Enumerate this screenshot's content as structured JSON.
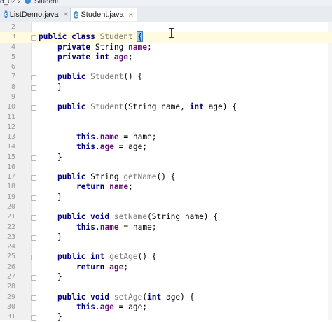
{
  "breadcrumb": {
    "project": "d_02",
    "file": "Student"
  },
  "tabs": [
    {
      "label": "ListDemo.java",
      "close": "×",
      "active": false
    },
    {
      "label": "Student.java",
      "close": "×",
      "active": true
    }
  ],
  "editor": {
    "current_line": "3",
    "lines": [
      {
        "num": "2",
        "code": ""
      },
      {
        "num": "3",
        "code": ""
      },
      {
        "num": "4",
        "code": ""
      },
      {
        "num": "5",
        "code": ""
      },
      {
        "num": "6",
        "code": ""
      },
      {
        "num": "7",
        "code": ""
      },
      {
        "num": "8",
        "code": ""
      },
      {
        "num": "9",
        "code": ""
      },
      {
        "num": "10",
        "code": ""
      },
      {
        "num": "11",
        "code": ""
      },
      {
        "num": "12",
        "code": ""
      },
      {
        "num": "13",
        "code": ""
      },
      {
        "num": "14",
        "code": ""
      },
      {
        "num": "15",
        "code": ""
      },
      {
        "num": "16",
        "code": ""
      },
      {
        "num": "17",
        "code": ""
      },
      {
        "num": "18",
        "code": ""
      },
      {
        "num": "19",
        "code": ""
      },
      {
        "num": "20",
        "code": ""
      },
      {
        "num": "21",
        "code": ""
      },
      {
        "num": "22",
        "code": ""
      },
      {
        "num": "23",
        "code": ""
      },
      {
        "num": "24",
        "code": ""
      },
      {
        "num": "25",
        "code": ""
      },
      {
        "num": "26",
        "code": ""
      },
      {
        "num": "27",
        "code": ""
      },
      {
        "num": "28",
        "code": ""
      },
      {
        "num": "29",
        "code": ""
      },
      {
        "num": "30",
        "code": ""
      },
      {
        "num": "31",
        "code": ""
      }
    ],
    "tokens": {
      "l3": [
        "public class ",
        "Student ",
        "{"
      ],
      "l4": [
        "private ",
        "String ",
        "name",
        ";"
      ],
      "l5": [
        "private int ",
        "age",
        ";"
      ],
      "l7": [
        "public ",
        "Student",
        "() {"
      ],
      "l8": [
        "}"
      ],
      "l10": [
        "public ",
        "Student",
        "(String name, ",
        "int ",
        "age) {"
      ],
      "l13": [
        "this",
        ".",
        "name",
        " = name;"
      ],
      "l14": [
        "this",
        ".",
        "age",
        " = age;"
      ],
      "l15": [
        "}"
      ],
      "l17": [
        "public ",
        "String ",
        "getName",
        "() {"
      ],
      "l18": [
        "return ",
        "name",
        ";"
      ],
      "l19": [
        "}"
      ],
      "l21": [
        "public void ",
        "setName",
        "(String name) {"
      ],
      "l22": [
        "this",
        ".",
        "name",
        " = name;"
      ],
      "l23": [
        "}"
      ],
      "l25": [
        "public int ",
        "getAge",
        "() {"
      ],
      "l26": [
        "return ",
        "age",
        ";"
      ],
      "l27": [
        "}"
      ],
      "l29": [
        "public void ",
        "setAge",
        "(",
        "int ",
        "age) {"
      ],
      "l30": [
        "this",
        ".",
        "age",
        " = age;"
      ],
      "l31": [
        "}"
      ]
    }
  }
}
